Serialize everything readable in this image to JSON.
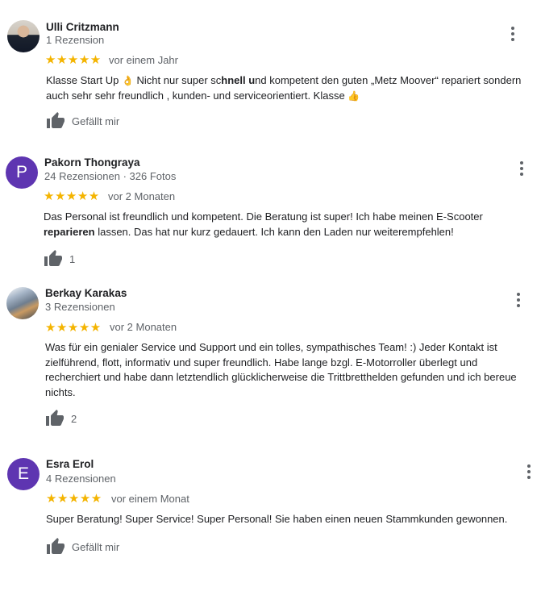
{
  "reviews": [
    {
      "name": "Ulli Critzmann",
      "meta": "1 Rezension",
      "stars": "★★★★★",
      "when": "vor einem Jahr",
      "text_a": "Klasse Start Up ",
      "emoji_a": "👌",
      "text_b": " Nicht nur super sc",
      "bold_b": "hnell u",
      "text_c": "nd kompetent den guten „Metz Moover“ repariert sondern auch sehr sehr freundlich , kunden-  und serviceorientiert. Klasse ",
      "emoji_c": "👍",
      "like_label": "Gefällt mir"
    },
    {
      "name": "Pakorn Thongraya",
      "avatar_letter": "P",
      "meta": "24 Rezensionen · 326 Fotos",
      "stars": "★★★★★",
      "when": "vor 2 Monaten",
      "text_a": "Das Personal ist freundlich und kompetent. Die Beratung ist super! Ich habe meinen E-Scooter ",
      "bold_a": "reparieren",
      "text_b": " lassen. Das hat nur kurz gedauert. Ich kann den Laden nur weiterempfehlen!",
      "like_label": "1"
    },
    {
      "name": "Berkay Karakas",
      "meta": "3 Rezensionen",
      "stars": "★★★★★",
      "when": "vor 2 Monaten",
      "text": "Was für ein genialer Service und Support und ein tolles, sympathisches Team! :) Jeder Kontakt ist zielführend, flott, informativ und super freundlich. Habe lange bzgl. E-Motorroller überlegt und recherchiert und habe dann letztendlich glücklicherweise die Trittbretthelden gefunden und ich bereue nichts.",
      "like_label": "2"
    },
    {
      "name": "Esra Erol",
      "avatar_letter": "E",
      "meta": "4 Rezensionen",
      "stars": "★★★★★",
      "when": "vor einem Monat",
      "text": "Super Beratung! Super Service! Super Personal! Sie haben einen neuen Stammkunden gewonnen.",
      "like_label": "Gefällt mir"
    }
  ],
  "icons": {
    "like": "thumbs-up-icon",
    "menu": "more-vert-icon"
  },
  "colors": {
    "star": "#f4b400",
    "avatar_purple": "#5e35b1",
    "secondary_text": "#5f6368"
  }
}
